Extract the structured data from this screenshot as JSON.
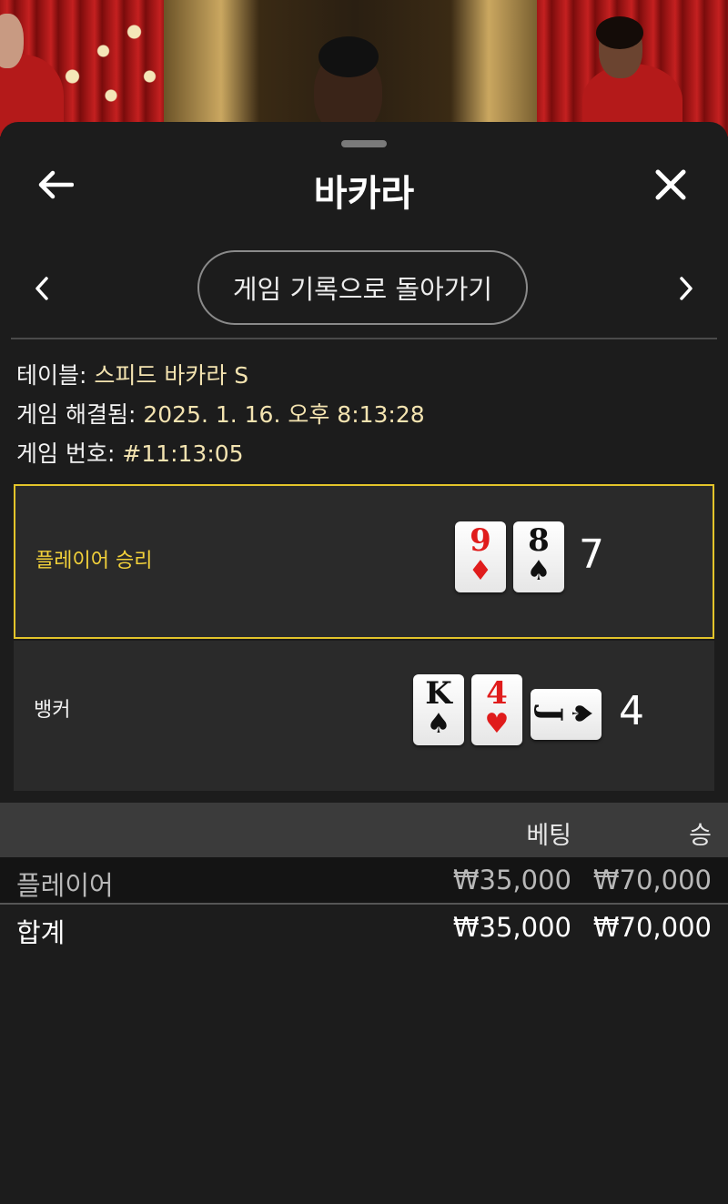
{
  "header": {
    "title": "바카라"
  },
  "navigation": {
    "return_label": "게임 기록으로 돌아가기"
  },
  "game_info": {
    "table_label": "테이블: ",
    "table_value": "스피드 바카라 S",
    "resolved_label": "게임 해결됨: ",
    "resolved_value": "2025. 1. 16. 오후 8:13:28",
    "number_label": "게임 번호: ",
    "number_value": "#11:13:05"
  },
  "result": {
    "player": {
      "label": "플레이어 승리",
      "score": "7",
      "cards": [
        {
          "rank": "9",
          "suit": "♦",
          "color": "#e01c1c"
        },
        {
          "rank": "8",
          "suit": "♠",
          "color": "#111111"
        }
      ]
    },
    "banker": {
      "label": "뱅커",
      "score": "4",
      "cards": [
        {
          "rank": "K",
          "suit": "♠",
          "color": "#111111"
        },
        {
          "rank": "4",
          "suit": "♥",
          "color": "#e01c1c"
        },
        {
          "rank": "J",
          "suit": "♠",
          "color": "#111111",
          "orientation": "sideways"
        }
      ]
    },
    "highlight_color": "#e3c42a"
  },
  "bets": {
    "columns": {
      "bet": "베팅",
      "win": "승"
    },
    "rows": [
      {
        "name": "플레이어",
        "bet": "₩35,000",
        "win": "₩70,000"
      }
    ],
    "total": {
      "name": "합계",
      "bet": "₩35,000",
      "win": "₩70,000"
    }
  },
  "icons": [
    "arrow-left-icon",
    "close-icon",
    "chevron-left-icon",
    "chevron-right-icon"
  ]
}
